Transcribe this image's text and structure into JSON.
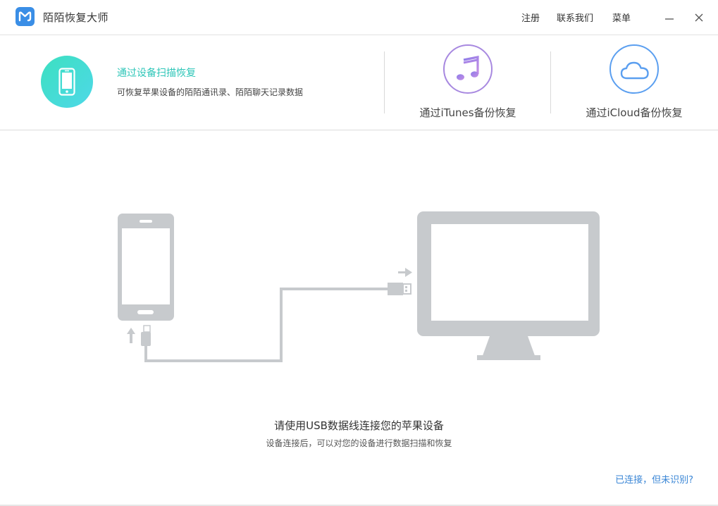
{
  "app": {
    "title": "陌陌恢复大师",
    "logo_icon": "momo-logo-icon",
    "accent": "#3a8ee6"
  },
  "header": {
    "register": "注册",
    "contact": "联系我们",
    "menu": "菜单"
  },
  "modes": {
    "device": {
      "title": "通过设备扫描恢复",
      "desc": "可恢复苹果设备的陌陌通讯录、陌陌聊天记录数据",
      "icon": "phone-icon",
      "color": "#2ec6b8"
    },
    "itunes": {
      "label": "通过iTunes备份恢复",
      "icon": "music-note-icon",
      "color": "#a889e0"
    },
    "icloud": {
      "label": "通过iCloud备份恢复",
      "icon": "cloud-icon",
      "color": "#5b9ff0"
    }
  },
  "main": {
    "title": "请使用USB数据线连接您的苹果设备",
    "subtitle": "设备连接后，可以对您的设备进行数据扫描和恢复",
    "help_link": "已连接，但未识别?"
  }
}
